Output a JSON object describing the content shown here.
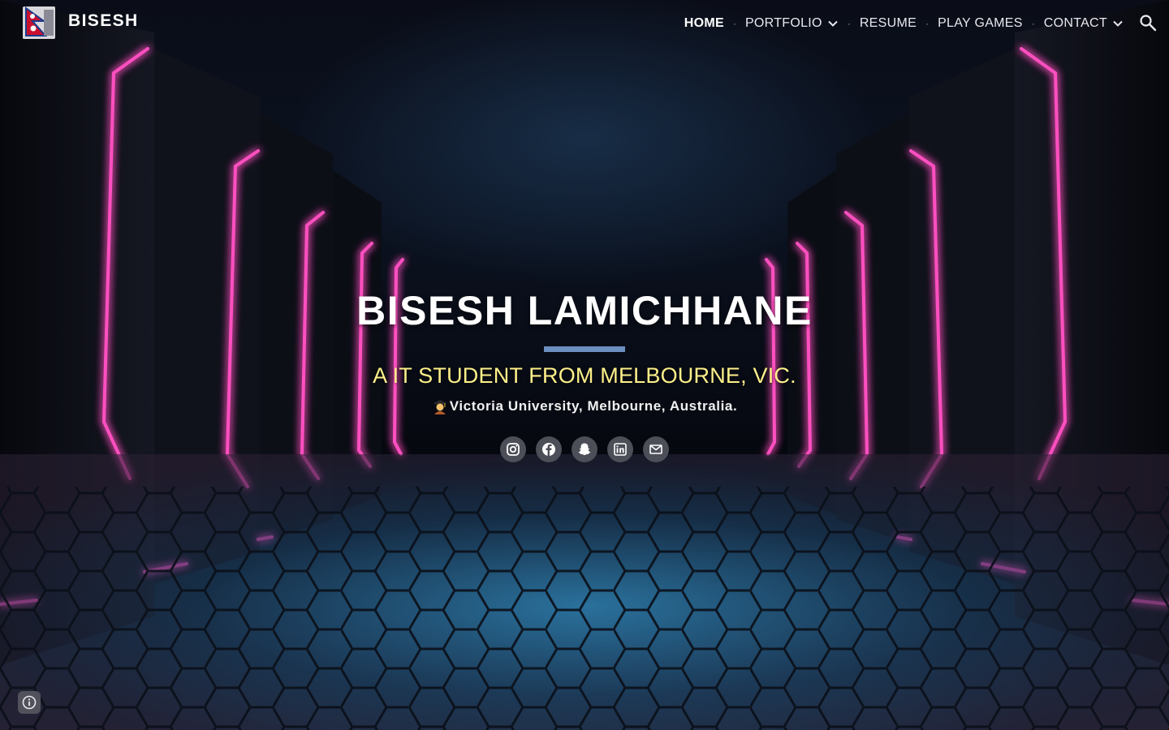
{
  "site": {
    "title": "BISESH",
    "logo_icon": "nepal-flag-logo"
  },
  "nav": {
    "items": [
      {
        "label": "HOME",
        "active": true,
        "has_dropdown": false
      },
      {
        "label": "PORTFOLIO",
        "active": false,
        "has_dropdown": true
      },
      {
        "label": "RESUME",
        "active": false,
        "has_dropdown": false
      },
      {
        "label": "PLAY GAMES",
        "active": false,
        "has_dropdown": false
      },
      {
        "label": "CONTACT",
        "active": false,
        "has_dropdown": true
      }
    ],
    "separator": "·",
    "search_icon": "search-icon"
  },
  "hero": {
    "title": "BISESH LAMICHHANE",
    "subtitle": "A IT STUDENT FROM MELBOURNE, VIC.",
    "university": "Victoria University, Melbourne, Australia.",
    "university_icon": "graduate-emoji-icon",
    "socials": [
      {
        "name": "instagram",
        "icon": "instagram-icon"
      },
      {
        "name": "facebook",
        "icon": "facebook-icon"
      },
      {
        "name": "snapchat",
        "icon": "snapchat-icon"
      },
      {
        "name": "linkedin",
        "icon": "linkedin-icon"
      },
      {
        "name": "email",
        "icon": "mail-icon"
      }
    ]
  },
  "footer": {
    "info_icon": "info-icon"
  },
  "colors": {
    "accent_rule": "#6b8fbf",
    "subtitle": "#fef08a",
    "neon": "#ff3fb4",
    "social_bg": "#4d4f58"
  }
}
